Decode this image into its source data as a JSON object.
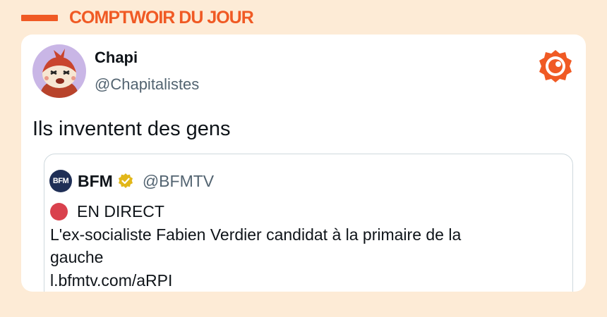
{
  "header": {
    "title": "COMPTWOIR DU JOUR"
  },
  "tweet": {
    "author": {
      "name": "Chapi",
      "handle": "@Chapitalistes",
      "avatar_icon": "cartoon-avatar"
    },
    "text": "Ils inventent des gens",
    "brand_icon": "comptoir-logo-icon",
    "quoted": {
      "author": {
        "logo_text": "BFM",
        "name": "BFM",
        "handle": "@BFMTV",
        "verified": true
      },
      "live_label": "EN DIRECT",
      "line1": "L'ex-socialiste Fabien Verdier candidat à la primaire de la",
      "line2": "gauche",
      "link": "l.bfmtv.com/aRPI"
    }
  },
  "colors": {
    "background": "#fdebd6",
    "accent": "#f05a24",
    "handle_gray": "#536471",
    "live_red": "#d9414d",
    "verified_gold": "#e2b719",
    "bfm_navy": "#1f2f56"
  }
}
